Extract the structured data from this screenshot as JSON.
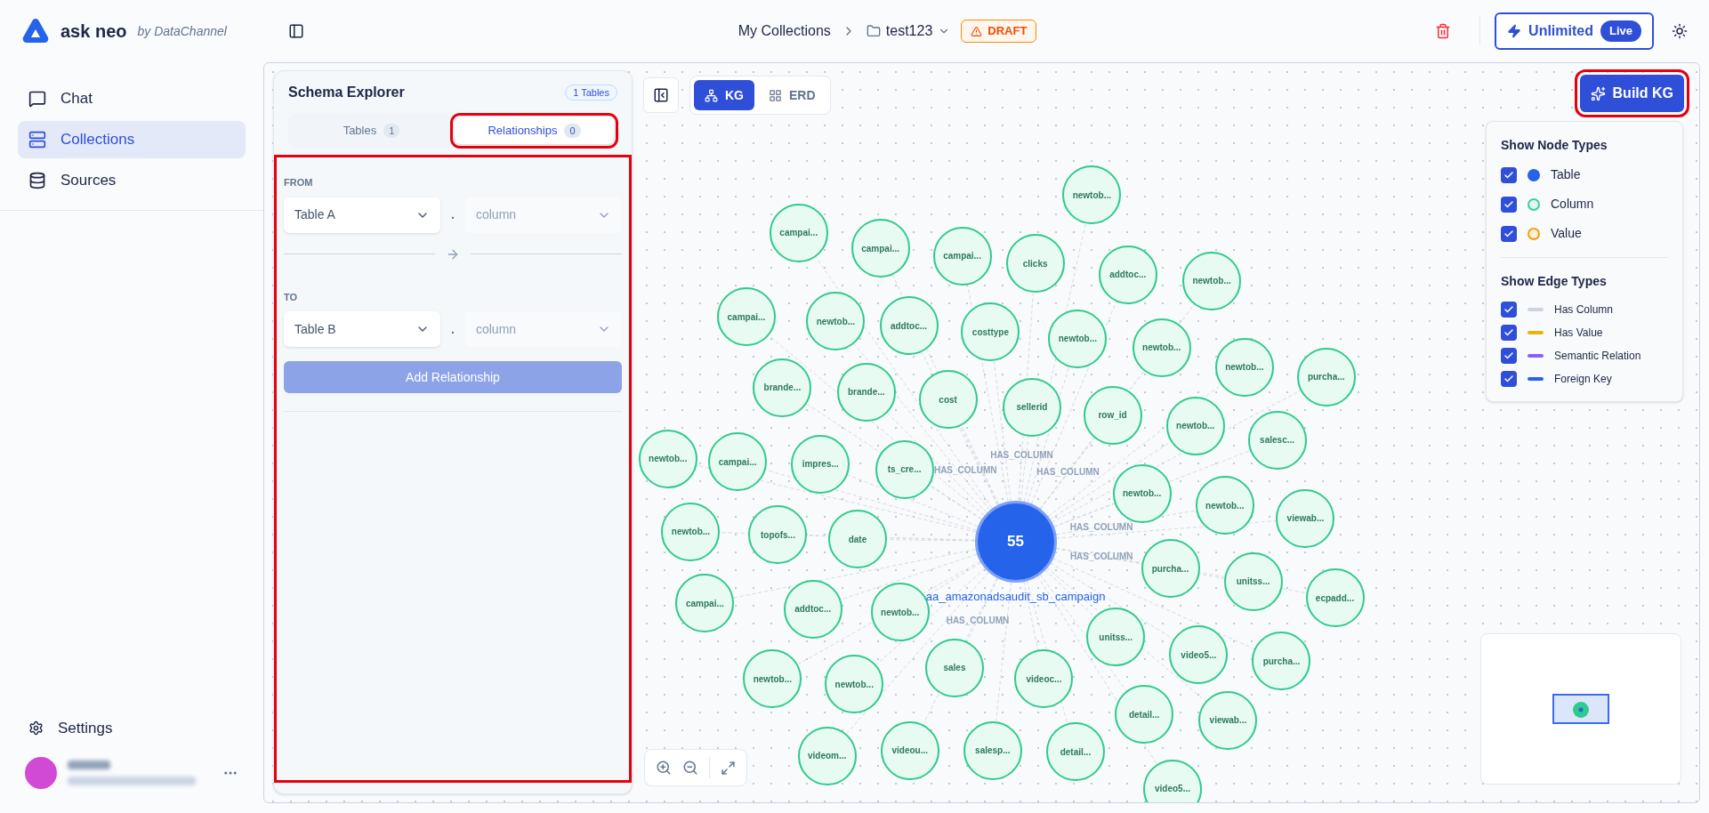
{
  "brand": {
    "name": "ask neo",
    "tagline": "by DataChannel"
  },
  "breadcrumb": {
    "root": "My Collections",
    "current": "test123",
    "badge": "DRAFT"
  },
  "plan": {
    "label": "Unlimited",
    "badge": "Live"
  },
  "sidebar": {
    "items": [
      {
        "label": "Chat",
        "kind": "chat",
        "selected": false
      },
      {
        "label": "Collections",
        "kind": "collections",
        "selected": true
      },
      {
        "label": "Sources",
        "kind": "sources",
        "selected": false
      }
    ],
    "settings": "Settings"
  },
  "schema_explorer": {
    "title": "Schema Explorer",
    "badge": "1 Tables",
    "tabs": [
      {
        "label": "Tables",
        "count": "1",
        "selected": false,
        "highlighted": false
      },
      {
        "label": "Relationships",
        "count": "0",
        "selected": true,
        "highlighted": true
      }
    ],
    "form": {
      "highlighted": true,
      "from_label": "FROM",
      "from_table": "Table A",
      "from_column": "column",
      "to_label": "TO",
      "to_table": "Table B",
      "to_column": "column",
      "joiner": ".",
      "button": "Add Relationship",
      "button_disabled": true
    }
  },
  "view_toggle": [
    {
      "label": "KG",
      "kind": "graph",
      "selected": true
    },
    {
      "label": "ERD",
      "kind": "grid",
      "selected": false
    }
  ],
  "build_button": {
    "label": "Build KG",
    "highlighted": true
  },
  "legend": {
    "node_title": "Show Node Types",
    "node_types": [
      {
        "label": "Table",
        "kind": "filled",
        "checked": true,
        "color": "#2563eb"
      },
      {
        "label": "Column",
        "kind": "ring",
        "checked": true,
        "color": "#34d399"
      },
      {
        "label": "Value",
        "kind": "ring",
        "checked": true,
        "color": "#f59e0b"
      }
    ],
    "edge_title": "Show Edge Types",
    "edge_types": [
      {
        "label": "Has Column",
        "checked": true,
        "color": "#cbd5e1"
      },
      {
        "label": "Has Value",
        "checked": true,
        "color": "#eab308"
      },
      {
        "label": "Semantic Relation",
        "checked": true,
        "color": "#8b5cf6"
      },
      {
        "label": "Foreign Key",
        "checked": true,
        "color": "#2563eb"
      }
    ]
  },
  "graph": {
    "table_node": {
      "count": "55",
      "label": "aa_amazonadsaudit_sb_campaign"
    },
    "column_nodes": [
      {
        "label": "newtob..."
      },
      {
        "label": "campai...",
        "edge_label": "HAS_COLUMN"
      },
      {
        "label": "campai..."
      },
      {
        "label": "campai..."
      },
      {
        "label": "clicks",
        "edge_label": "HAS_COLUMN"
      },
      {
        "label": "addtoc..."
      },
      {
        "label": "newtob..."
      },
      {
        "label": "campai..."
      },
      {
        "label": "newtob..."
      },
      {
        "label": "addtoc..."
      },
      {
        "label": "costtype"
      },
      {
        "label": "newtob..."
      },
      {
        "label": "newtob...",
        "edge_label": "HAS_COLUMN"
      },
      {
        "label": "newtob..."
      },
      {
        "label": "purcha..."
      },
      {
        "label": "brande..."
      },
      {
        "label": "brande..."
      },
      {
        "label": "cost"
      },
      {
        "label": "sellerid"
      },
      {
        "label": "row_id"
      },
      {
        "label": "newtob..."
      },
      {
        "label": "salesc..."
      },
      {
        "label": "newtob..."
      },
      {
        "label": "campai..."
      },
      {
        "label": "impres..."
      },
      {
        "label": "ts_cre..."
      },
      {
        "label": "newtob..."
      },
      {
        "label": "newtob...",
        "edge_label": "HAS_COLUMN"
      },
      {
        "label": "viewab..."
      },
      {
        "label": "newtob..."
      },
      {
        "label": "topofs..."
      },
      {
        "label": "date"
      },
      {
        "label": "purcha..."
      },
      {
        "label": "unitss...",
        "edge_label": "HAS_COLUMN"
      },
      {
        "label": "ecpadd..."
      },
      {
        "label": "campai..."
      },
      {
        "label": "addtoc..."
      },
      {
        "label": "newtob..."
      },
      {
        "label": "unitss..."
      },
      {
        "label": "video5..."
      },
      {
        "label": "purcha..."
      },
      {
        "label": "newtob..."
      },
      {
        "label": "newtob..."
      },
      {
        "label": "sales",
        "edge_label": "HAS_COLUMN"
      },
      {
        "label": "videoc..."
      },
      {
        "label": "detail..."
      },
      {
        "label": "viewab..."
      },
      {
        "label": "videom..."
      },
      {
        "label": "videou..."
      },
      {
        "label": "salesp..."
      },
      {
        "label": "detail..."
      },
      {
        "label": "video5..."
      }
    ]
  }
}
